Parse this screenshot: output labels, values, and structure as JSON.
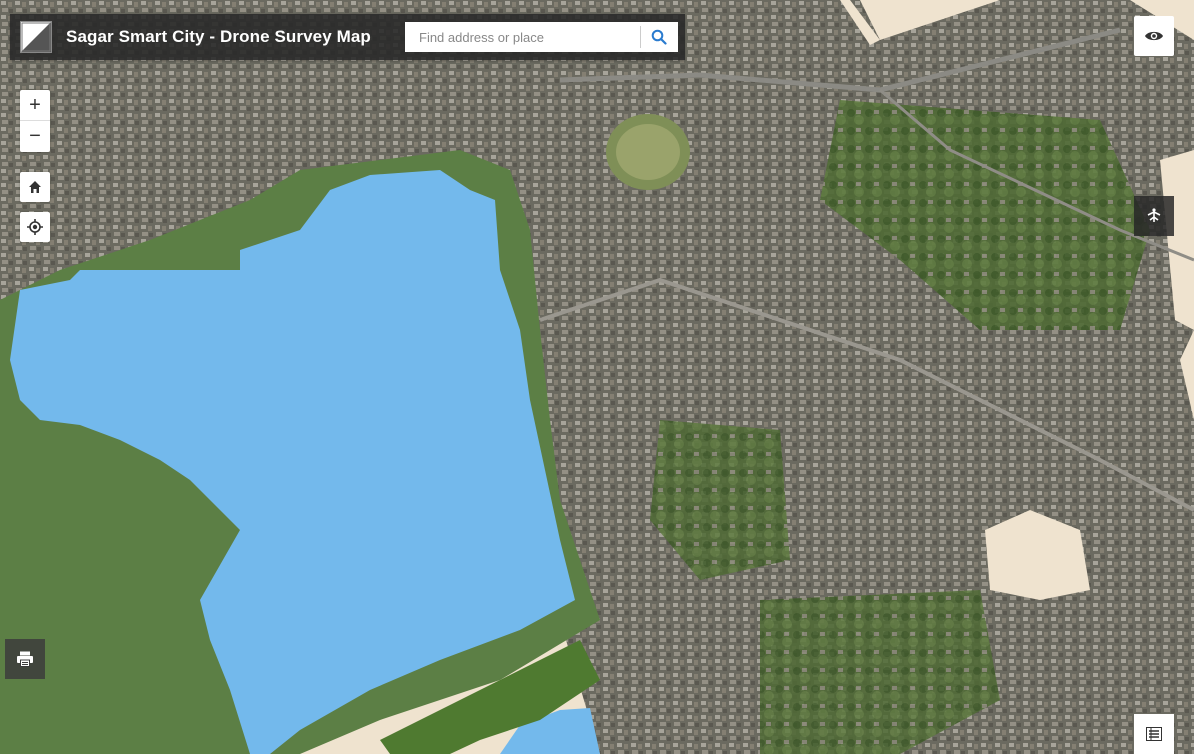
{
  "header": {
    "title": "Sagar Smart City - Drone Survey Map",
    "logo_icon": "dronemaps-logo"
  },
  "search": {
    "placeholder": "Find address or place",
    "value": "",
    "button_icon": "search-icon"
  },
  "map_controls": {
    "zoom_in_label": "+",
    "zoom_out_label": "−",
    "home_icon": "home-icon",
    "locate_icon": "locate-icon"
  },
  "right_controls": {
    "visibility_icon": "eye-icon",
    "layers_icon": "layers-icon",
    "legend_icon": "list-icon"
  },
  "left_bottom_controls": {
    "print_icon": "printer-icon"
  },
  "colors": {
    "header_bg": "#282828",
    "lake": "#73b9ec",
    "basemap_land": "#efe3cf",
    "accent_search": "#2a7bcf"
  }
}
